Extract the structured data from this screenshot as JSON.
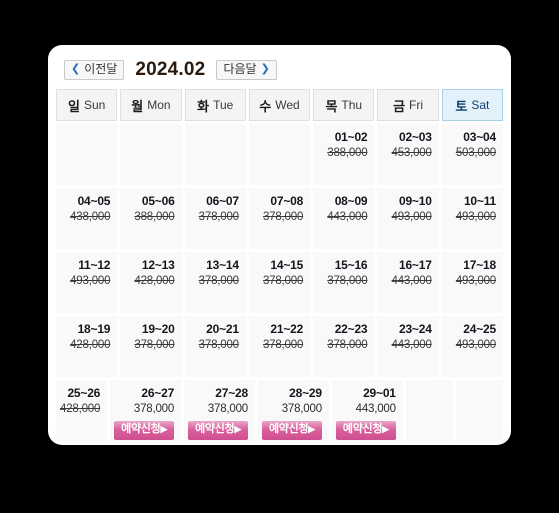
{
  "header": {
    "prev_label": "이전달",
    "prev_arrow": "❮",
    "next_label": "다음달",
    "next_arrow": "❯",
    "month_title": "2024.02"
  },
  "weekdays": [
    {
      "ko": "일",
      "en": "Sun",
      "highlight": false
    },
    {
      "ko": "월",
      "en": "Mon",
      "highlight": false
    },
    {
      "ko": "화",
      "en": "Tue",
      "highlight": false
    },
    {
      "ko": "수",
      "en": "Wed",
      "highlight": false
    },
    {
      "ko": "목",
      "en": "Thu",
      "highlight": false
    },
    {
      "ko": "금",
      "en": "Fri",
      "highlight": false
    },
    {
      "ko": "토",
      "en": "Sat",
      "highlight": true
    }
  ],
  "book_button_label": "예약신청",
  "book_button_caret": "▶",
  "colors": {
    "page_background": "#000000",
    "panel_background": "#ffffff",
    "cell_background": "#f9f9f9",
    "weekday_background": "#f4f4f4",
    "saturday_background": "#e3f1fb",
    "saturday_border": "#a9cfe8",
    "month_title": "#2b1a0e",
    "nav_arrow": "#2a6fc0",
    "book_button": "#d9609c"
  },
  "weeks": [
    {
      "days": [
        {
          "empty": true
        },
        {
          "empty": true
        },
        {
          "empty": true
        },
        {
          "empty": true
        },
        {
          "empty": false,
          "range": "01~02",
          "price": "388,000",
          "sold_out": true,
          "bookable": false
        },
        {
          "empty": false,
          "range": "02~03",
          "price": "453,000",
          "sold_out": true,
          "bookable": false
        },
        {
          "empty": false,
          "range": "03~04",
          "price": "503,000",
          "sold_out": true,
          "bookable": false
        }
      ]
    },
    {
      "days": [
        {
          "empty": false,
          "range": "04~05",
          "price": "438,000",
          "sold_out": true,
          "bookable": false
        },
        {
          "empty": false,
          "range": "05~06",
          "price": "388,000",
          "sold_out": true,
          "bookable": false
        },
        {
          "empty": false,
          "range": "06~07",
          "price": "378,000",
          "sold_out": true,
          "bookable": false
        },
        {
          "empty": false,
          "range": "07~08",
          "price": "378,000",
          "sold_out": true,
          "bookable": false
        },
        {
          "empty": false,
          "range": "08~09",
          "price": "443,000",
          "sold_out": true,
          "bookable": false
        },
        {
          "empty": false,
          "range": "09~10",
          "price": "493,000",
          "sold_out": true,
          "bookable": false
        },
        {
          "empty": false,
          "range": "10~11",
          "price": "493,000",
          "sold_out": true,
          "bookable": false
        }
      ]
    },
    {
      "days": [
        {
          "empty": false,
          "range": "11~12",
          "price": "493,000",
          "sold_out": true,
          "bookable": false
        },
        {
          "empty": false,
          "range": "12~13",
          "price": "428,000",
          "sold_out": true,
          "bookable": false
        },
        {
          "empty": false,
          "range": "13~14",
          "price": "378,000",
          "sold_out": true,
          "bookable": false
        },
        {
          "empty": false,
          "range": "14~15",
          "price": "378,000",
          "sold_out": true,
          "bookable": false
        },
        {
          "empty": false,
          "range": "15~16",
          "price": "378,000",
          "sold_out": true,
          "bookable": false
        },
        {
          "empty": false,
          "range": "16~17",
          "price": "443,000",
          "sold_out": true,
          "bookable": false
        },
        {
          "empty": false,
          "range": "17~18",
          "price": "493,000",
          "sold_out": true,
          "bookable": false
        }
      ]
    },
    {
      "days": [
        {
          "empty": false,
          "range": "18~19",
          "price": "428,000",
          "sold_out": true,
          "bookable": false
        },
        {
          "empty": false,
          "range": "19~20",
          "price": "378,000",
          "sold_out": true,
          "bookable": false
        },
        {
          "empty": false,
          "range": "20~21",
          "price": "378,000",
          "sold_out": true,
          "bookable": false
        },
        {
          "empty": false,
          "range": "21~22",
          "price": "378,000",
          "sold_out": true,
          "bookable": false
        },
        {
          "empty": false,
          "range": "22~23",
          "price": "378,000",
          "sold_out": true,
          "bookable": false
        },
        {
          "empty": false,
          "range": "23~24",
          "price": "443,000",
          "sold_out": true,
          "bookable": false
        },
        {
          "empty": false,
          "range": "24~25",
          "price": "493,000",
          "sold_out": true,
          "bookable": false
        }
      ]
    },
    {
      "days": [
        {
          "empty": false,
          "range": "25~26",
          "price": "428,000",
          "sold_out": true,
          "bookable": false
        },
        {
          "empty": false,
          "range": "26~27",
          "price": "378,000",
          "sold_out": false,
          "bookable": true
        },
        {
          "empty": false,
          "range": "27~28",
          "price": "378,000",
          "sold_out": false,
          "bookable": true
        },
        {
          "empty": false,
          "range": "28~29",
          "price": "378,000",
          "sold_out": false,
          "bookable": true
        },
        {
          "empty": false,
          "range": "29~01",
          "price": "443,000",
          "sold_out": false,
          "bookable": true
        },
        {
          "empty": true
        },
        {
          "empty": true
        }
      ]
    }
  ]
}
